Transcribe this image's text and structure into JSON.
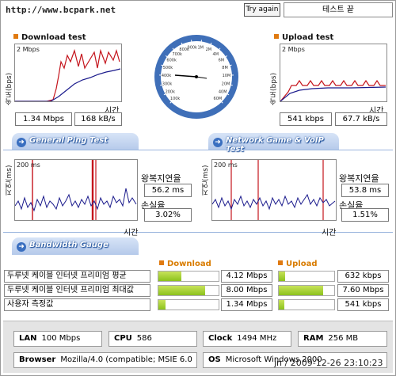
{
  "header": {
    "url_text": "http://www.bcpark.net",
    "try_again_label": "Try again",
    "test_state": "테스트 끝"
  },
  "download": {
    "title": "Download test",
    "ylabel": "속도(bps)",
    "max_label": "2 Mbps",
    "xlabel": "시간",
    "mbps": "1.34 Mbps",
    "kbs": "168 kB/s"
  },
  "upload": {
    "title": "Upload test",
    "ylabel": "속도(bps)",
    "max_label": "2 Mbps",
    "xlabel": "시간",
    "kbps": "541 kbps",
    "kbs": "67.7 kB/s"
  },
  "gauge": {
    "ticks": [
      "100k",
      "200k",
      "300k",
      "400k",
      "500k",
      "600k",
      "700k",
      "800k",
      "900k",
      "1M",
      "2M",
      "4M",
      "6M",
      "8M",
      "10M",
      "20M",
      "40M",
      "60M"
    ]
  },
  "ping": {
    "title": "General Ping Test",
    "ylabel": "지연(ms)",
    "max_label": "200 ms",
    "xlabel": "시간",
    "rtt_label": "왕복지연율",
    "loss_label": "손실율",
    "rtt_value": "56.2 ms",
    "loss_value": "3.02%"
  },
  "game": {
    "title": "Network Game & VoIP Test",
    "ylabel": "지연(ms)",
    "max_label": "200 ms",
    "xlabel": "시간",
    "rtt_label": "왕복지연율",
    "loss_label": "손실율",
    "rtt_value": "53.8 ms",
    "loss_value": "1.51%"
  },
  "bandwidth": {
    "title": "Bandwidth Gauge",
    "download_head": "Download",
    "upload_head": "Upload",
    "rows": [
      {
        "label": "두루넷 케이블 인터넷 프리미엄 평균",
        "down_value": "4.12 Mbps",
        "down_fraction": 0.38,
        "up_value": "632 kbps",
        "up_fraction": 0.12
      },
      {
        "label": "두루넷 케이블 인터넷 프리미엄 최대값",
        "down_value": "8.00 Mbps",
        "down_fraction": 0.78,
        "up_value": "7.60 Mbps",
        "up_fraction": 0.8
      },
      {
        "label": "사용자 측정값",
        "down_value": "1.34 Mbps",
        "down_fraction": 0.12,
        "up_value": "541 kbps",
        "up_fraction": 0.1
      }
    ]
  },
  "system": {
    "lan_label": "LAN",
    "lan_value": "100 Mbps",
    "cpu_label": "CPU",
    "cpu_value": "586",
    "clock_label": "Clock",
    "clock_value": "1494 MHz",
    "ram_label": "RAM",
    "ram_value": "256 MB",
    "browser_label": "Browser",
    "browser_value": "Mozilla/4.0 (compatible; MSIE 6.0",
    "os_label": "OS",
    "os_value": "Microsoft Windows 2000",
    "timestamp": "jn / 2009-12-26 23:10:23"
  },
  "colors": {
    "accent_orange": "#e07a10",
    "section_blue": "#3a6fc0",
    "series_red": "#c4141c",
    "series_blue": "#1a1a8c",
    "bar_green": "#8cc21c"
  }
}
